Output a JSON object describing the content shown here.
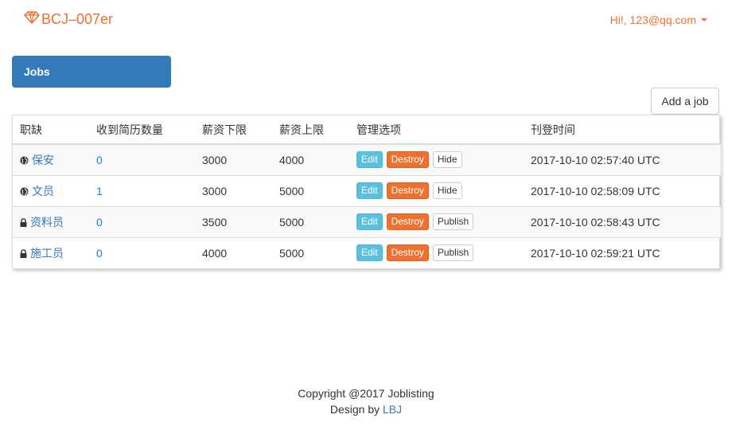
{
  "navbar": {
    "brand": "BCJ–007er",
    "user_menu": "Hi!, 123@qq.com",
    "brand_color": "#ed7130"
  },
  "tab": {
    "label": "Jobs",
    "color": "#337ab7"
  },
  "actions": {
    "add_job": "Add a job"
  },
  "table": {
    "headers": [
      "职缺",
      "收到简历数量",
      "薪资下限",
      "薪资上限",
      "管理选项",
      "刊登时间"
    ],
    "rows": [
      {
        "icon": "globe-icon",
        "title": "保安",
        "resumes": "0",
        "wage_lower": "3000",
        "wage_upper": "4000",
        "edit": "Edit",
        "destroy": "Destroy",
        "toggle": "Hide",
        "published_at": "2017-10-10 02:57:40 UTC"
      },
      {
        "icon": "globe-icon",
        "title": "文员",
        "resumes": "1",
        "wage_lower": "3000",
        "wage_upper": "5000",
        "edit": "Edit",
        "destroy": "Destroy",
        "toggle": "Hide",
        "published_at": "2017-10-10 02:58:09 UTC"
      },
      {
        "icon": "lock-icon",
        "title": "资料员",
        "resumes": "0",
        "wage_lower": "3500",
        "wage_upper": "5000",
        "edit": "Edit",
        "destroy": "Destroy",
        "toggle": "Publish",
        "published_at": "2017-10-10 02:58:43 UTC"
      },
      {
        "icon": "lock-icon",
        "title": "施工员",
        "resumes": "0",
        "wage_lower": "4000",
        "wage_upper": "5000",
        "edit": "Edit",
        "destroy": "Destroy",
        "toggle": "Publish",
        "published_at": "2017-10-10 02:59:21 UTC"
      }
    ]
  },
  "footer": {
    "copyright": "Copyright @2017 Joblisting",
    "design_prefix": "Design by",
    "design_link": "LBJ"
  }
}
